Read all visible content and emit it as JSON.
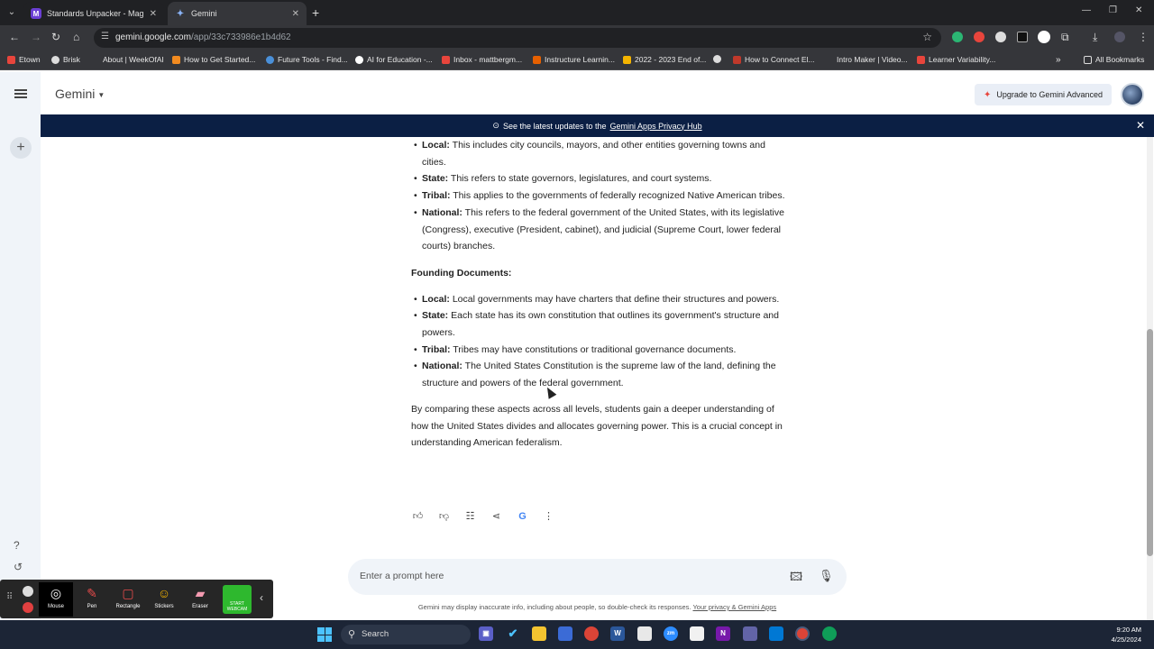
{
  "browser": {
    "tabs": [
      {
        "title": "Standards Unpacker - MagicSc",
        "active": false
      },
      {
        "title": "Gemini",
        "active": true
      }
    ],
    "url_host": "gemini.google.com",
    "url_path": "/app/33c733986e1b4d62",
    "bookmarks": [
      "Etown",
      "Brisk",
      "About | WeekOfAI",
      "How to Get Started...",
      "Future Tools - Find...",
      "AI for Education -...",
      "Inbox - mattbergm...",
      "Instructure Learnin...",
      "2022 - 2023 End of...",
      "How to Connect El...",
      "Intro Maker | Video...",
      "Learner Variability..."
    ],
    "all_bookmarks": "All Bookmarks"
  },
  "app": {
    "name": "Gemini",
    "upgrade_label": "Upgrade to Gemini Advanced",
    "banner": {
      "text": "See the latest updates to the",
      "link": "Gemini Apps Privacy Hub"
    }
  },
  "response": {
    "list1": [
      {
        "term": "Local:",
        "text": "This includes city councils, mayors, and other entities governing towns and cities."
      },
      {
        "term": "State:",
        "text": "This refers to state governors, legislatures, and court systems."
      },
      {
        "term": "Tribal:",
        "text": "This applies to the governments of federally recognized Native American tribes."
      },
      {
        "term": "National:",
        "text": "This refers to the federal government of the United States, with its legislative (Congress), executive (President, cabinet), and judicial (Supreme Court, lower federal courts) branches."
      }
    ],
    "section_title": "Founding Documents:",
    "list2": [
      {
        "term": "Local:",
        "text": "Local governments may have charters that define their structures and powers."
      },
      {
        "term": "State:",
        "text": "Each state has its own constitution that outlines its government's structure and powers."
      },
      {
        "term": "Tribal:",
        "text": "Tribes may have constitutions or traditional governance documents."
      },
      {
        "term": "National:",
        "text": "The United States Constitution is the supreme law of the land, defining the structure and powers of the federal government."
      }
    ],
    "conclusion": "By comparing these aspects across all levels, students gain a deeper understanding of how the United States divides and allocates governing power. This is a crucial concept in understanding American federalism."
  },
  "prompt": {
    "placeholder": "Enter a prompt here"
  },
  "disclaimer": {
    "text": "Gemini may display inaccurate info, including about people, so double-check its responses.",
    "link": "Your privacy & Gemini Apps"
  },
  "recorder": {
    "tools": [
      "Mouse",
      "Pen",
      "Rectangle",
      "Stickers",
      "Eraser"
    ],
    "webcam_label": "START WEBCAM"
  },
  "taskbar": {
    "search_label": "Search",
    "time": "9:20 AM",
    "date": "4/25/2024"
  }
}
